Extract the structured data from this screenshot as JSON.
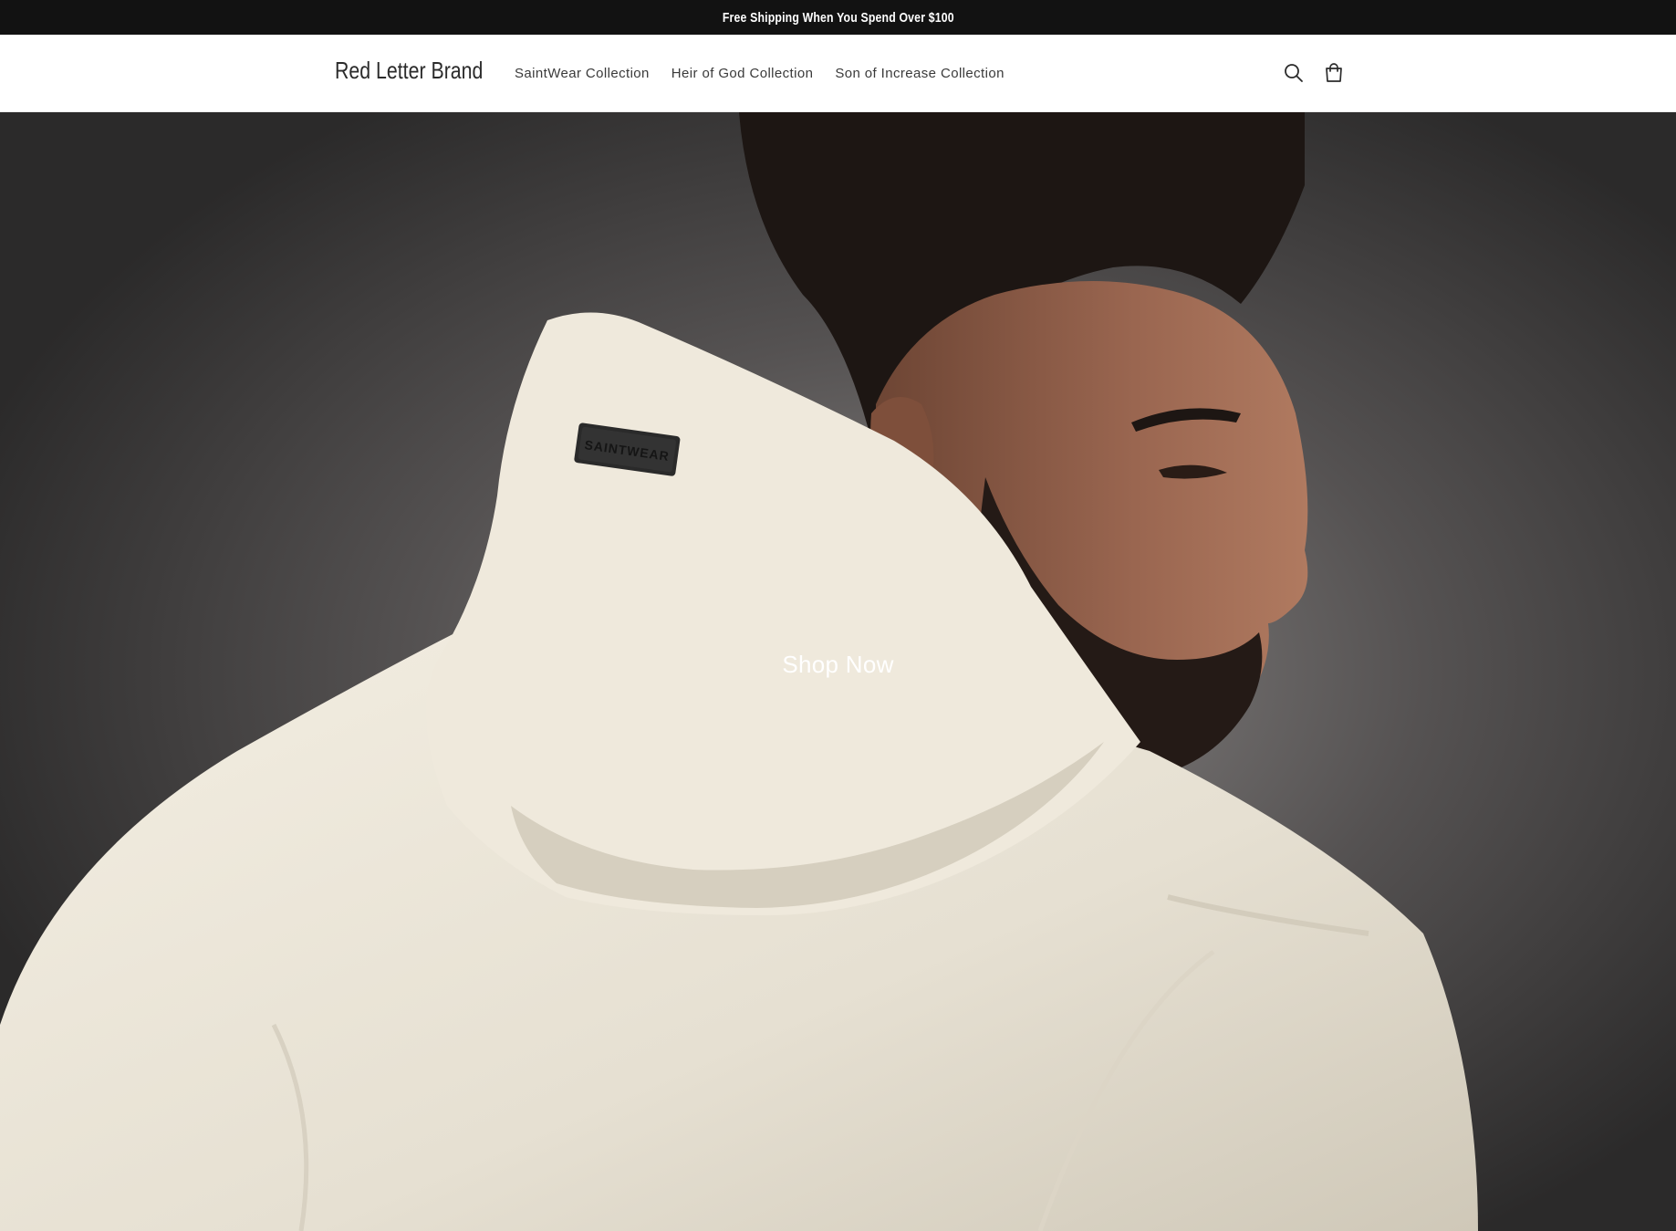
{
  "announcement": {
    "text": "Free Shipping When You Spend Over $100"
  },
  "header": {
    "brand": "Red Letter Brand",
    "nav": [
      {
        "label": "SaintWear Collection"
      },
      {
        "label": "Heir of God Collection"
      },
      {
        "label": "Son of Increase Collection"
      }
    ],
    "icons": {
      "search": "search-icon",
      "cart": "cart-icon"
    }
  },
  "hero": {
    "cta_label": "Shop Now",
    "patch_text": "SAINTWEAR",
    "colors": {
      "hoodie": "#ece6d8",
      "background": "#3a3838",
      "skin": "#8a5a44",
      "hair": "#1d1613"
    }
  }
}
